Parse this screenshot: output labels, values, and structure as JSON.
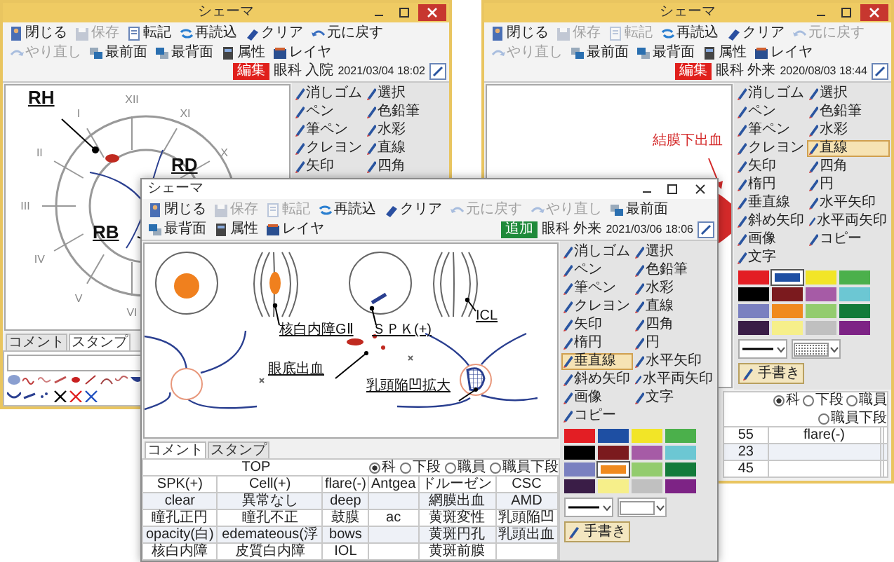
{
  "windows": [
    {
      "kind": "accent",
      "title": "シェーマ",
      "toolbar": [
        {
          "label": "閉じる",
          "disabled": false
        },
        {
          "label": "保存",
          "disabled": true
        },
        {
          "label": "転記",
          "disabled": false
        },
        {
          "label": "再読込",
          "disabled": false
        },
        {
          "label": "クリア",
          "disabled": false
        },
        {
          "label": "元に戻す",
          "disabled": false
        },
        {
          "label": "やり直し",
          "disabled": true
        },
        {
          "label": "最前面",
          "disabled": false
        },
        {
          "label": "最背面",
          "disabled": false
        },
        {
          "label": "属性",
          "disabled": false
        },
        {
          "label": "レイヤ",
          "disabled": false
        }
      ],
      "badge": {
        "text": "編集",
        "kind": "edit"
      },
      "department": "眼科 入院",
      "timestamp": "2021/03/04 18:02",
      "canvas": {
        "kind": "fundus-clock",
        "numerals": [
          "XII",
          "XI",
          "X",
          "VI",
          "V",
          "IV",
          "III",
          "II",
          "I"
        ],
        "labels": [
          "RH",
          "RD",
          "RB"
        ]
      },
      "tools": [
        {
          "label": "消しゴム",
          "selected": false
        },
        {
          "label": "選択",
          "selected": false
        },
        {
          "label": "ペン",
          "selected": false
        },
        {
          "label": "色鉛筆",
          "selected": false
        },
        {
          "label": "筆ペン",
          "selected": false
        },
        {
          "label": "水彩",
          "selected": false
        },
        {
          "label": "クレヨン",
          "selected": false
        },
        {
          "label": "直線",
          "selected": false
        },
        {
          "label": "矢印",
          "selected": false
        },
        {
          "label": "四角",
          "selected": false
        }
      ],
      "bottom": {
        "kind": "stamps",
        "tabs": [
          {
            "label": "コメント",
            "selected": false
          },
          {
            "label": "スタンプ",
            "selected": true
          }
        ]
      }
    },
    {
      "kind": "accent",
      "title": "シェーマ",
      "toolbar": [
        {
          "label": "閉じる",
          "disabled": false
        },
        {
          "label": "保存",
          "disabled": true
        },
        {
          "label": "転記",
          "disabled": true
        },
        {
          "label": "再読込",
          "disabled": false
        },
        {
          "label": "クリア",
          "disabled": false
        },
        {
          "label": "元に戻す",
          "disabled": true
        },
        {
          "label": "やり直し",
          "disabled": true
        },
        {
          "label": "最前面",
          "disabled": false
        },
        {
          "label": "最背面",
          "disabled": false
        },
        {
          "label": "属性",
          "disabled": false
        },
        {
          "label": "レイヤ",
          "disabled": false
        }
      ],
      "badge": {
        "text": "編集",
        "kind": "edit"
      },
      "department": "眼科 外来",
      "timestamp": "2020/08/03 18:44",
      "canvas": {
        "kind": "conjunctiva",
        "labels": [
          "結膜下出血"
        ]
      },
      "tools": [
        {
          "label": "消しゴム",
          "selected": false
        },
        {
          "label": "選択",
          "selected": false
        },
        {
          "label": "ペン",
          "selected": false
        },
        {
          "label": "色鉛筆",
          "selected": false
        },
        {
          "label": "筆ペン",
          "selected": false
        },
        {
          "label": "水彩",
          "selected": false
        },
        {
          "label": "クレヨン",
          "selected": false
        },
        {
          "label": "直線",
          "selected": true
        },
        {
          "label": "矢印",
          "selected": false
        },
        {
          "label": "四角",
          "selected": false
        },
        {
          "label": "楕円",
          "selected": false
        },
        {
          "label": "円",
          "selected": false
        },
        {
          "label": "垂直線",
          "selected": false
        },
        {
          "label": "水平矢印",
          "selected": false
        },
        {
          "label": "斜め矢印",
          "selected": false
        },
        {
          "label": "水平両矢印",
          "selected": false
        },
        {
          "label": "画像",
          "selected": false
        },
        {
          "label": "コピー",
          "selected": false
        },
        {
          "label": "文字",
          "selected": false
        }
      ],
      "colors": [
        {
          "color": "#e31e24",
          "selected": false
        },
        {
          "color": "#1e4fa3",
          "selected": true
        },
        {
          "color": "#f2e527",
          "selected": false
        },
        {
          "color": "#4bb04b",
          "selected": false
        },
        {
          "color": "#000000",
          "selected": false
        },
        {
          "color": "#7b1a1e",
          "selected": false
        },
        {
          "color": "#a65ba6",
          "selected": false
        },
        {
          "color": "#6cc7d3",
          "selected": false
        },
        {
          "color": "#7a80c0",
          "selected": false
        },
        {
          "color": "#f08a1e",
          "selected": false
        },
        {
          "color": "#93cc6e",
          "selected": false
        },
        {
          "color": "#137b3a",
          "selected": false
        },
        {
          "color": "#3a1d47",
          "selected": false
        },
        {
          "color": "#f6ef8a",
          "selected": false
        },
        {
          "color": "#c0c0c0",
          "selected": false
        },
        {
          "color": "#7d2385",
          "selected": false
        }
      ],
      "line_style": {
        "kind": "solid"
      },
      "fill": {
        "kind": "dotted"
      },
      "handwriting_button": "手書き",
      "bottom": {
        "kind": "table",
        "table": {
          "options": [
            {
              "label": "科",
              "selected": true
            },
            {
              "label": "下段",
              "selected": false
            },
            {
              "label": "職員",
              "selected": false
            },
            {
              "label": "職員下段",
              "selected": false
            }
          ],
          "rows": [
            [
              "55",
              "flare(-)",
              null,
              null
            ],
            [
              "23",
              null,
              null,
              null
            ],
            [
              "45",
              null,
              null,
              null
            ]
          ]
        }
      }
    },
    {
      "kind": "plain",
      "title": "シェーマ",
      "toolbar": [
        {
          "label": "閉じる",
          "disabled": false
        },
        {
          "label": "保存",
          "disabled": true
        },
        {
          "label": "転記",
          "disabled": true
        },
        {
          "label": "再読込",
          "disabled": false
        },
        {
          "label": "クリア",
          "disabled": false
        },
        {
          "label": "元に戻す",
          "disabled": true
        },
        {
          "label": "やり直し",
          "disabled": true
        },
        {
          "label": "最前面",
          "disabled": false
        },
        {
          "label": "最背面",
          "disabled": false
        },
        {
          "label": "属性",
          "disabled": false
        },
        {
          "label": "レイヤ",
          "disabled": false
        }
      ],
      "badge": {
        "text": "追加",
        "kind": "add"
      },
      "department": "眼科 外来",
      "timestamp": "2021/03/06 18:06",
      "canvas": {
        "kind": "lens-fundus",
        "labels": [
          "核白内障GⅡ",
          "ＳＰＫ(+)",
          "ICL",
          "眼底出血",
          "乳頭陥凹拡大"
        ]
      },
      "tools": [
        {
          "label": "消しゴム",
          "selected": false
        },
        {
          "label": "選択",
          "selected": false
        },
        {
          "label": "ペン",
          "selected": false
        },
        {
          "label": "色鉛筆",
          "selected": false
        },
        {
          "label": "筆ペン",
          "selected": false
        },
        {
          "label": "水彩",
          "selected": false
        },
        {
          "label": "クレヨン",
          "selected": false
        },
        {
          "label": "直線",
          "selected": false
        },
        {
          "label": "矢印",
          "selected": false
        },
        {
          "label": "四角",
          "selected": false
        },
        {
          "label": "楕円",
          "selected": false
        },
        {
          "label": "円",
          "selected": false
        },
        {
          "label": "垂直線",
          "selected": true
        },
        {
          "label": "水平矢印",
          "selected": false
        },
        {
          "label": "斜め矢印",
          "selected": false
        },
        {
          "label": "水平両矢印",
          "selected": false
        },
        {
          "label": "画像",
          "selected": false
        },
        {
          "label": "文字",
          "selected": false
        },
        {
          "label": "コピー",
          "selected": false
        }
      ],
      "colors": [
        {
          "color": "#e31e24",
          "selected": false
        },
        {
          "color": "#1e4fa3",
          "selected": false
        },
        {
          "color": "#f2e527",
          "selected": false
        },
        {
          "color": "#4bb04b",
          "selected": false
        },
        {
          "color": "#000000",
          "selected": false
        },
        {
          "color": "#7b1a1e",
          "selected": false
        },
        {
          "color": "#a65ba6",
          "selected": false
        },
        {
          "color": "#6cc7d3",
          "selected": false
        },
        {
          "color": "#7a80c0",
          "selected": false
        },
        {
          "color": "#f08a1e",
          "selected": true
        },
        {
          "color": "#93cc6e",
          "selected": false
        },
        {
          "color": "#137b3a",
          "selected": false
        },
        {
          "color": "#3a1d47",
          "selected": false
        },
        {
          "color": "#f6ef8a",
          "selected": false
        },
        {
          "color": "#c0c0c0",
          "selected": false
        },
        {
          "color": "#7d2385",
          "selected": false
        }
      ],
      "line_style": {
        "kind": "solid"
      },
      "fill": {
        "kind": "blank"
      },
      "handwriting_button": "手書き",
      "bottom": {
        "kind": "table",
        "tabs": [
          {
            "label": "コメント",
            "selected": true
          },
          {
            "label": "スタンプ",
            "selected": false
          }
        ],
        "table": {
          "title": "TOP",
          "options": [
            {
              "label": "科",
              "selected": true
            },
            {
              "label": "下段",
              "selected": false
            },
            {
              "label": "職員",
              "selected": false
            },
            {
              "label": "職員下段",
              "selected": false
            }
          ],
          "rows": [
            [
              "SPK(+)",
              "Cell(+)",
              "flare(-)",
              "Antgea",
              "ドルーゼン",
              "CSC",
              null
            ],
            [
              "clear",
              "異常なし",
              "deep",
              null,
              "網膜出血",
              "AMD",
              null
            ],
            [
              "瞳孔正円",
              "瞳孔不正",
              "鼓膜",
              "ac",
              "黄斑変性",
              "乳頭陥凹",
              null
            ],
            [
              "opacity(白)",
              "edemateous(浮",
              "bows",
              null,
              "黄斑円孔",
              "乳頭出血",
              null
            ],
            [
              "核白内障",
              "皮質白内障",
              "IOL",
              null,
              "黄斑前膜",
              null,
              null
            ]
          ]
        }
      }
    }
  ]
}
